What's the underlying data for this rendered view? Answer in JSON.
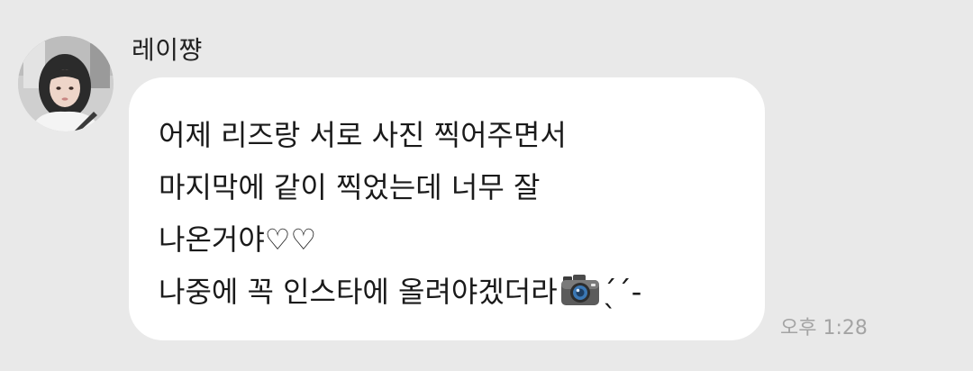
{
  "message": {
    "sender_name": "레이쨩",
    "lines": [
      "어제 리즈랑 서로 사진 찍어주면서",
      "마지막에 같이 찍었는데 너무 잘",
      "나온거야♡♡",
      "나중에 꼭 인스타에 올려야겠더라"
    ],
    "trail_text": "ˎ́ˊ-",
    "camera_icon": "camera-icon",
    "timestamp": "오후 1:28"
  },
  "colors": {
    "background": "#e9e9e9",
    "bubble": "#ffffff",
    "text": "#1a1a1a",
    "timestamp": "#a4a4a4"
  }
}
